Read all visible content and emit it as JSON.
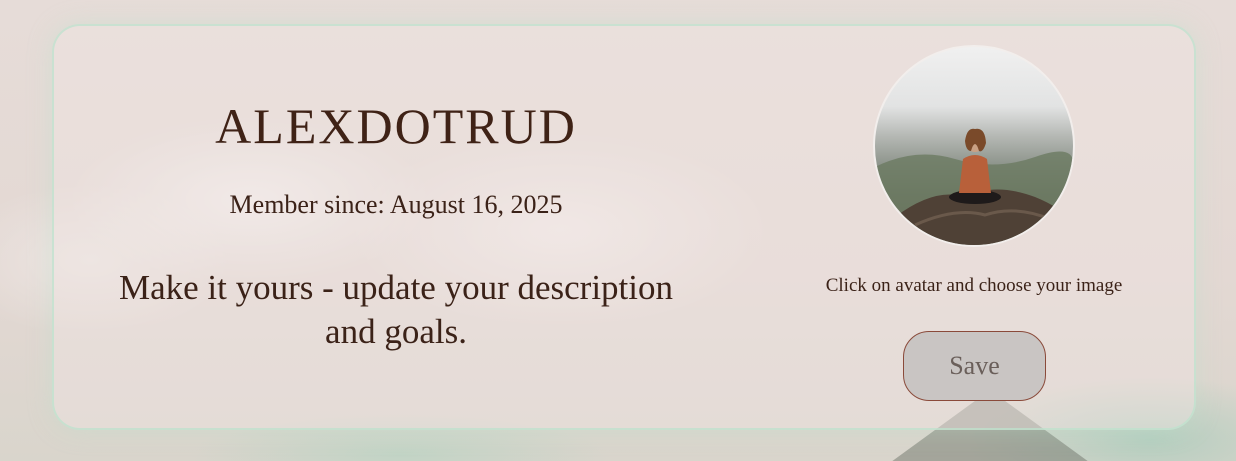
{
  "profile": {
    "username": "ALEXDOTRUD",
    "member_since": "Member since: August 16, 2025",
    "description": "Make it yours - update your description and goals."
  },
  "avatar": {
    "hint": "Click on avatar and choose your image",
    "image_alt": "avatar-photo-icon"
  },
  "actions": {
    "save_label": "Save"
  },
  "colors": {
    "text": "#3b2218",
    "card_border": "#bee1cd",
    "button_bg": "#c9c5c3",
    "button_border": "#8a4a3a"
  }
}
